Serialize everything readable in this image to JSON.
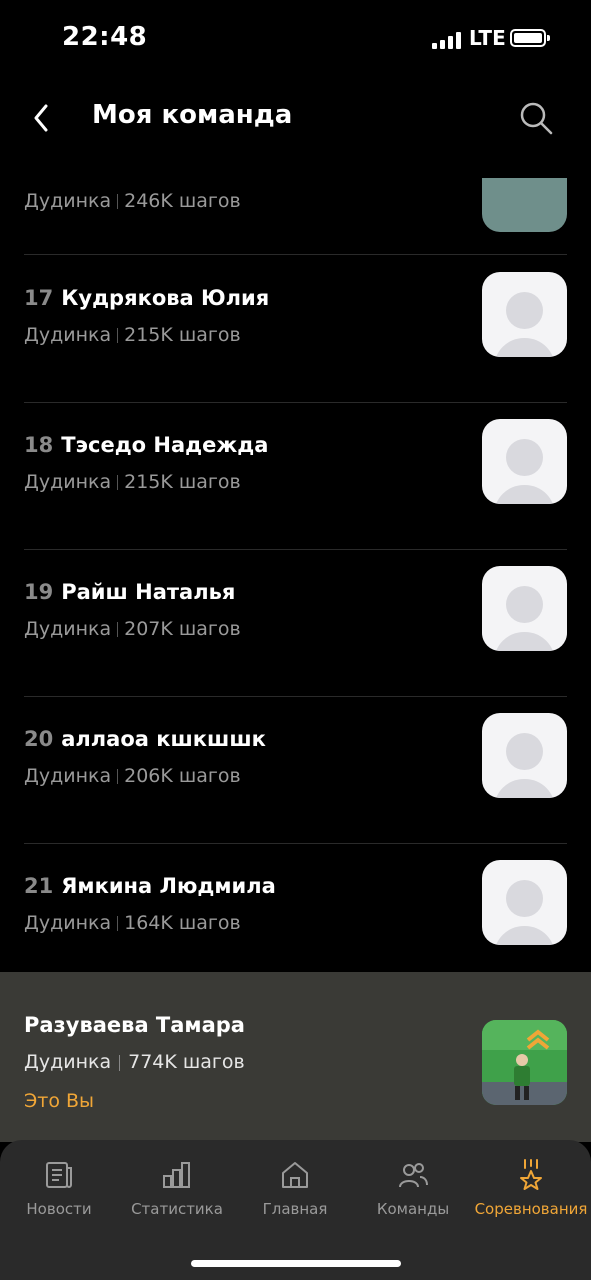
{
  "status": {
    "time": "22:48",
    "network": "LTE"
  },
  "header": {
    "title": "Моя команда"
  },
  "rows": [
    {
      "rank": "",
      "name": "",
      "city": "Дудинка",
      "steps": "246K шагов"
    },
    {
      "rank": "17",
      "name": "Кудрякова Юлия",
      "city": "Дудинка",
      "steps": "215K шагов"
    },
    {
      "rank": "18",
      "name": "Тэседо Надежда",
      "city": "Дудинка",
      "steps": "215K шагов"
    },
    {
      "rank": "19",
      "name": "Райш Наталья",
      "city": "Дудинка",
      "steps": "207K шагов"
    },
    {
      "rank": "20",
      "name": "аллаоа кшкшшк",
      "city": "Дудинка",
      "steps": "206K шагов"
    },
    {
      "rank": "21",
      "name": "Ямкина Людмила",
      "city": "Дудинка",
      "steps": "164K шагов"
    }
  ],
  "me": {
    "name": "Разуваева Тамара",
    "city": "Дудинка",
    "steps": "774K шагов",
    "you_label": "Это Вы"
  },
  "tabs": [
    {
      "label": "Новости",
      "icon": "news-icon"
    },
    {
      "label": "Статистика",
      "icon": "statistics-icon"
    },
    {
      "label": "Главная",
      "icon": "home-icon"
    },
    {
      "label": "Команды",
      "icon": "teams-icon"
    },
    {
      "label": "Соревнования",
      "icon": "competitions-icon",
      "active": true
    }
  ],
  "colors": {
    "accent": "#f0a637",
    "background": "#000000",
    "panel": "#3a3a36",
    "tabbar": "#2a2a2a"
  }
}
